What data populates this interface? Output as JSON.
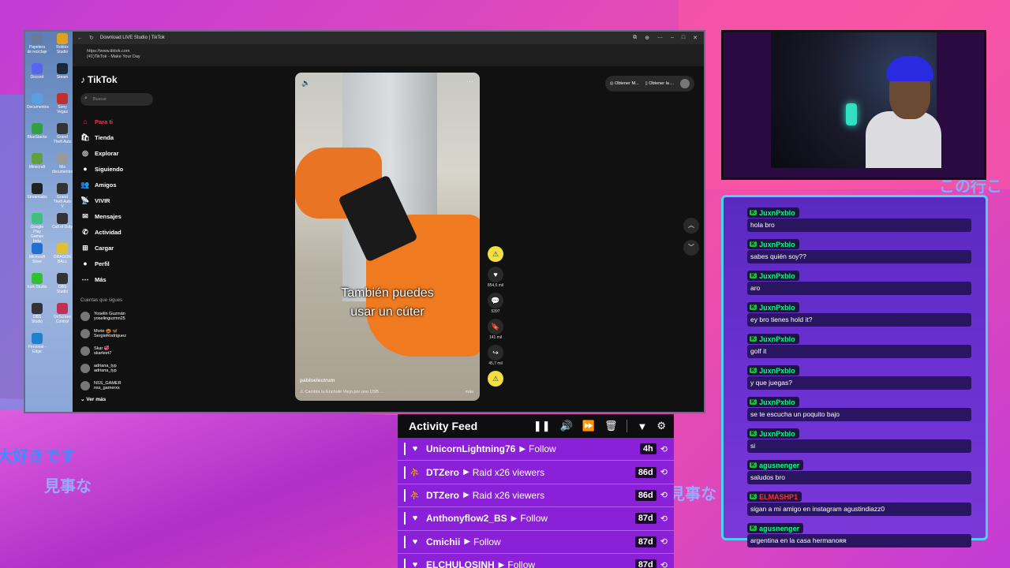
{
  "browser": {
    "title": "Download LIVE Studio | TikTok",
    "url": "https://www.tiktok.com",
    "tab_label": "(41)TikTok - Make Your Day"
  },
  "desktop_icons": [
    {
      "label": "Papelera de reciclaje"
    },
    {
      "label": "Roblox Studio"
    },
    {
      "label": "Discord"
    },
    {
      "label": "Steam"
    },
    {
      "label": "Documentos"
    },
    {
      "label": "Sony Vegas"
    },
    {
      "label": "BlueStacks"
    },
    {
      "label": "Grand Theft Auto"
    },
    {
      "label": "Minecraft"
    },
    {
      "label": "Mis documentos"
    },
    {
      "label": "Streamlabs"
    },
    {
      "label": "Grand Theft Auto V"
    },
    {
      "label": "Google Play Games beta"
    },
    {
      "label": "Call of Duty"
    },
    {
      "label": "Microsoft Store"
    },
    {
      "label": "DRAGON BALL"
    },
    {
      "label": "Kick Studio"
    },
    {
      "label": "OBS Studio"
    },
    {
      "label": "OBS Studio"
    },
    {
      "label": "OnScreen Control"
    },
    {
      "label": "Personal - Edge"
    }
  ],
  "tiktok": {
    "logo": "TikTok",
    "search_placeholder": "Buscar",
    "nav": [
      {
        "label": "Para ti",
        "icon": "home-icon"
      },
      {
        "label": "Tienda",
        "icon": "shop-icon"
      },
      {
        "label": "Explorar",
        "icon": "compass-icon"
      },
      {
        "label": "Siguiendo",
        "icon": "following-icon"
      },
      {
        "label": "Amigos",
        "icon": "friends-icon"
      },
      {
        "label": "VIVIR",
        "icon": "live-icon"
      },
      {
        "label": "Mensajes",
        "icon": "messages-icon"
      },
      {
        "label": "Actividad",
        "icon": "activity-icon"
      },
      {
        "label": "Cargar",
        "icon": "upload-icon"
      },
      {
        "label": "Perfil",
        "icon": "profile-icon"
      },
      {
        "label": "Más",
        "icon": "more-icon"
      }
    ],
    "following_title": "Cuentas que sigues",
    "following": [
      {
        "name": "Yoselin Guzmán",
        "handle": "yoselinguzmn25"
      },
      {
        "name": "Mvrie 🎃 🦋",
        "handle": "SergieRodriguez"
      },
      {
        "name": "Skar 💞",
        "handle": "skarleet7"
      },
      {
        "name": "adriana_typ",
        "handle": "adriana_typ"
      },
      {
        "name": "NSS_GAMER",
        "handle": "nss_gamerxx"
      }
    ],
    "see_more": "Ver más",
    "top_buttons": [
      "Obtener M...",
      "Obtener la ..."
    ],
    "video": {
      "caption_line1": "También puedes",
      "caption_line2": "usar un cúter",
      "author": "pabloelectrum",
      "description": "⚠ Cambia tu Enchufe Viejo por uno USB ...",
      "more": "más"
    },
    "actions": [
      {
        "icon": "heart-icon",
        "count": "854,6 mil"
      },
      {
        "icon": "comment-icon",
        "count": "5397"
      },
      {
        "icon": "bookmark-icon",
        "count": "141 mil"
      },
      {
        "icon": "share-icon",
        "count": "45,7 mil"
      }
    ]
  },
  "chat": {
    "messages": [
      {
        "user": "JuxnPxblo",
        "text": "hola bro"
      },
      {
        "user": "JuxnPxblo",
        "text": "sabes quién soy??"
      },
      {
        "user": "JuxnPxblo",
        "text": "aro"
      },
      {
        "user": "JuxnPxblo",
        "text": "ey bro tienes hold it?"
      },
      {
        "user": "JuxnPxblo",
        "text": "golf it"
      },
      {
        "user": "JuxnPxblo",
        "text": "y que juegas?"
      },
      {
        "user": "JuxnPxblo",
        "text": "se te escucha un poquito bajo"
      },
      {
        "user": "JuxnPxblo",
        "text": "si"
      },
      {
        "user": "agusnenger",
        "text": "saludos bro"
      },
      {
        "user": "ELMASHP1",
        "text": "sigan a mi amigo en instagram agustindiazz0"
      },
      {
        "user": "agusnenger",
        "text": "argentina en la casa hermanoʀʀ"
      }
    ]
  },
  "feed": {
    "title": "Activity Feed",
    "rows": [
      {
        "icon": "heart-icon",
        "name": "UnicornLightning76",
        "event": "Follow",
        "age": "4h"
      },
      {
        "icon": "raid-icon",
        "name": "DTZero",
        "event": "Raid x26 viewers",
        "age": "86d"
      },
      {
        "icon": "raid-icon",
        "name": "DTZero",
        "event": "Raid x26 viewers",
        "age": "86d"
      },
      {
        "icon": "heart-icon",
        "name": "Anthonyflow2_BS",
        "event": "Follow",
        "age": "87d"
      },
      {
        "icon": "heart-icon",
        "name": "Cmichii",
        "event": "Follow",
        "age": "87d"
      },
      {
        "icon": "heart-icon",
        "name": "ELCHULOSINH",
        "event": "Follow",
        "age": "87d"
      }
    ]
  },
  "overlay_text": {
    "jp1": "大好きです",
    "jp2": "見事な",
    "jp3": "見事な",
    "jp4": "この行こ"
  }
}
